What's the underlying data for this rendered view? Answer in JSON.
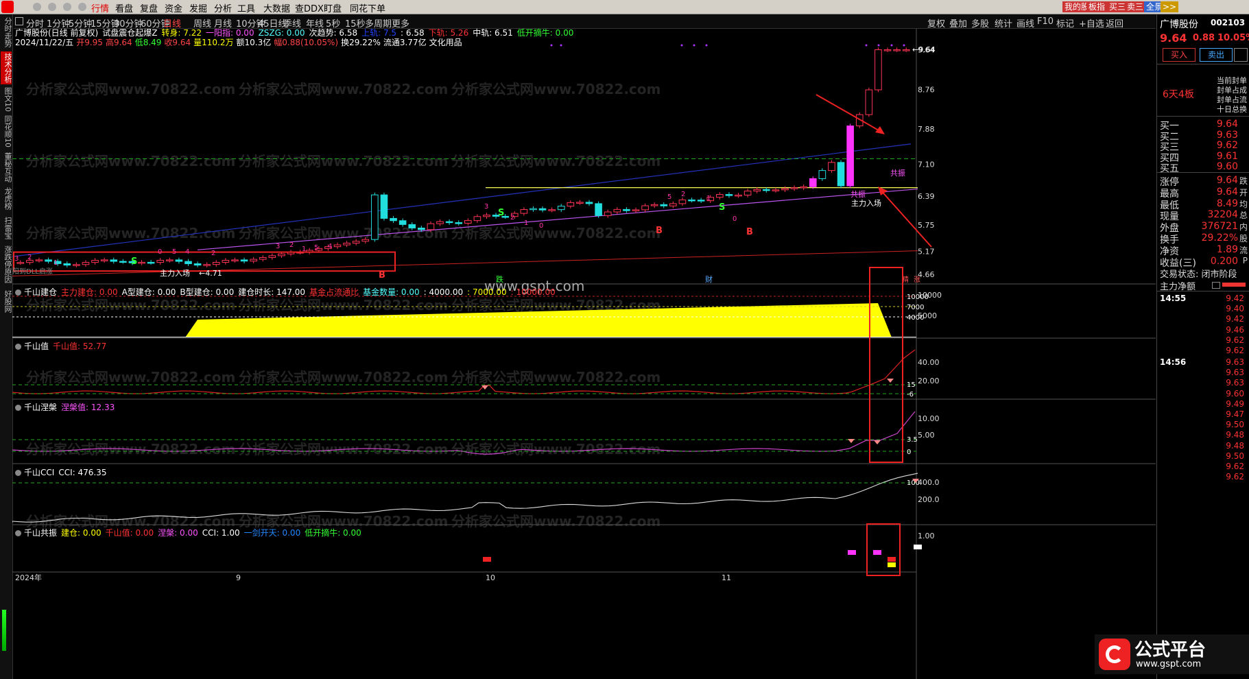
{
  "topbar": {
    "nav": [
      "行情",
      "看盘",
      "复盘",
      "资金",
      "发掘",
      "分析",
      "工具",
      "大数据",
      "查DDX",
      "盯盘",
      "同花下单"
    ],
    "right_buttons": [
      "我的股",
      "板指",
      "买三",
      "卖三",
      "全景",
      ">>"
    ]
  },
  "periods": [
    "分时",
    "1分钟",
    "5分钟",
    "15分钟",
    "30分钟",
    "60分钟",
    "日线",
    "周线",
    "月线",
    "10分钟",
    "45日线",
    "季线",
    "年线",
    "5秒",
    "15秒",
    "多周期",
    "更多"
  ],
  "toolbar_right": [
    "复权",
    "叠加",
    "多股",
    "统计",
    "画线",
    "F10",
    "标记",
    "+自选",
    "返回"
  ],
  "left_tabs": [
    "分时走势",
    "技术分析",
    "图文10",
    "同花顺10",
    "董秘互动",
    "龙虎榜",
    "扫雷宝",
    "涨跌停原因",
    "好股网"
  ],
  "main_chart": {
    "title_line1": [
      {
        "text": "广博股份(日线 前复权)",
        "color": "#ffffff"
      },
      {
        "text": "试盘震仓起爆Z",
        "color": "#ffffff"
      },
      {
        "text": "转身: 7.22",
        "color": "#ffff00"
      },
      {
        "text": "一阳指: 0.00",
        "color": "#ff55ff"
      },
      {
        "text": "ZSZG: 0.00",
        "color": "#55ffff"
      },
      {
        "text": "次趋势: 6.58",
        "color": "#ffffff"
      },
      {
        "text": "上轨: 7.5",
        "color": "#2244ff"
      },
      {
        "text": ": 6.58",
        "color": "#ffffff"
      },
      {
        "text": "下轨: 5.26",
        "color": "#ff3333"
      },
      {
        "text": "中轨: 6.51",
        "color": "#ffffff"
      },
      {
        "text": "低开摘牛: 0.00",
        "color": "#33ff33"
      }
    ],
    "title_line2": [
      {
        "text": "2024/11/22/五",
        "color": "#ffffff"
      },
      {
        "text": "开9.95",
        "color": "#ff4444"
      },
      {
        "text": "高9.64",
        "color": "#ff4444"
      },
      {
        "text": "低8.49",
        "color": "#33ff33"
      },
      {
        "text": "收9.64",
        "color": "#ff4444"
      },
      {
        "text": "量110.2万",
        "color": "#ffff00"
      },
      {
        "text": "额10.3亿",
        "color": "#ffffff"
      },
      {
        "text": "幅0.88(10.05%)",
        "color": "#ff4444"
      },
      {
        "text": "换29.22%",
        "color": "#ffffff"
      },
      {
        "text": "流通3.77亿",
        "color": "#ffffff"
      },
      {
        "text": "文化用品",
        "color": "#ffffff"
      }
    ],
    "yaxis": [
      "9.64",
      "8.76",
      "7.88",
      "7.10",
      "6.39",
      "5.75",
      "5.17",
      "4.66"
    ],
    "ylabel_last": "9.64",
    "annotations": {
      "main_force_enter_1": "主力入场",
      "main_force_enter_2": "主力入场",
      "resonance_1": "共振",
      "resonance_2": "共振",
      "arrow_val": "←4.71",
      "bl_label": "阳到DLL启涨",
      "die_label": "跌",
      "cai_label": "财",
      "jing_label": "精",
      "zhang_label": "涨",
      "b_marks": [
        "B",
        "B",
        "B"
      ],
      "s_marks": [
        "S",
        "S",
        "S"
      ],
      "num_marks": [
        "3",
        "2",
        "1",
        "0",
        "5",
        "4",
        "2",
        "3",
        "2",
        "1",
        "5",
        "4",
        "3",
        "2",
        "1",
        "0",
        "5",
        "2",
        "1",
        "0",
        "5",
        "4",
        "2",
        "3",
        "2",
        "1",
        "0"
      ]
    }
  },
  "panels": {
    "jiancang": {
      "title": [
        {
          "text": "千山建仓",
          "color": "#ffffff"
        },
        {
          "text": "主力建仓: 0.00",
          "color": "#ff3333"
        },
        {
          "text": "A型建仓: 0.00",
          "color": "#ffffff"
        },
        {
          "text": "B型建仓: 0.00",
          "color": "#ffffff"
        },
        {
          "text": "建仓时长: 147.00",
          "color": "#ffffff"
        },
        {
          "text": "基金占流通比",
          "color": "#ff3333"
        },
        {
          "text": "基金数量: 0.00",
          "color": "#55ffff"
        },
        {
          "text": ": 4000.00",
          "color": "#ffffff"
        },
        {
          "text": ": 7000.00",
          "color": "#ffff00"
        },
        {
          "text": ": 10000.00",
          "color": "#ff3333"
        }
      ],
      "yaxis": [
        "10000",
        "5000"
      ],
      "levels": [
        "10000",
        "7000",
        "4000"
      ]
    },
    "qianshanzhi": {
      "title": [
        {
          "text": "千山值",
          "color": "#ffffff"
        },
        {
          "text": "千山值: 52.77",
          "color": "#ff3333"
        }
      ],
      "yaxis": [
        "40.00",
        "20.00"
      ],
      "levels": [
        "15",
        "-6"
      ]
    },
    "niepan": {
      "title": [
        {
          "text": "千山涅槃",
          "color": "#ffffff"
        },
        {
          "text": "涅槃值: 12.33",
          "color": "#ff55ff"
        }
      ],
      "yaxis": [
        "10.00",
        "5.00"
      ],
      "levels": [
        "3.5",
        "0"
      ]
    },
    "cci": {
      "title": [
        {
          "text": "千山CCI",
          "color": "#ffffff"
        },
        {
          "text": "CCI: 476.35",
          "color": "#ffffff"
        }
      ],
      "yaxis": [
        "400.0",
        "200.0"
      ],
      "levels": [
        "100"
      ]
    },
    "gongzhen": {
      "title": [
        {
          "text": "千山共振",
          "color": "#ffffff"
        },
        {
          "text": "建仓: 0.00",
          "color": "#ffff00"
        },
        {
          "text": "千山值: 0.00",
          "color": "#ff3333"
        },
        {
          "text": "涅槃: 0.00",
          "color": "#ff55ff"
        },
        {
          "text": "CCI: 1.00",
          "color": "#ffffff"
        },
        {
          "text": "一剑开天: 0.00",
          "color": "#2288ff"
        },
        {
          "text": "低开摘牛: 0.00",
          "color": "#33ff33"
        }
      ],
      "yaxis": [
        "1.00"
      ]
    }
  },
  "xaxis": [
    "2024年",
    "9",
    "10",
    "11"
  ],
  "site_watermark": "www.gspt.com",
  "bg_watermark": "分析家公式网www.70822.com",
  "right_panel": {
    "stock_name": "广博股份",
    "code": "002103",
    "price": "9.64",
    "change": "0.88",
    "pct": "10.05%",
    "buy_btn": "买入",
    "sell_btn": "卖出",
    "limit_label": "6天4板",
    "seal_lines": [
      "当前封单",
      "封单占成",
      "封单占流",
      "十日总换"
    ],
    "bids": [
      {
        "label": "买一",
        "value": "9.64"
      },
      {
        "label": "买二",
        "value": "9.63"
      },
      {
        "label": "买三",
        "value": "9.62"
      },
      {
        "label": "买四",
        "value": "9.61"
      },
      {
        "label": "买五",
        "value": "9.60"
      }
    ],
    "stats": [
      {
        "label": "涨停",
        "value": "9.64",
        "extra": "跌"
      },
      {
        "label": "最高",
        "value": "9.64",
        "extra": "开"
      },
      {
        "label": "最低",
        "value": "8.49",
        "extra": "均"
      },
      {
        "label": "现量",
        "value": "32204",
        "extra": "总"
      },
      {
        "label": "外盘",
        "value": "376721",
        "extra": "内"
      },
      {
        "label": "换手",
        "value": "29.22%",
        "extra": "股"
      },
      {
        "label": "净资",
        "value": "1.89",
        "extra": "流"
      },
      {
        "label": "收益(三)",
        "value": "0.200",
        "extra": "P"
      }
    ],
    "trade_state": "交易状态: 闭市阶段",
    "main_net": "主力净额",
    "ticks_time1": "14:55",
    "ticks1": [
      "9.42",
      "9.40",
      "9.42",
      "9.46",
      "9.62",
      "9.62"
    ],
    "ticks_time2": "14:56",
    "ticks2": [
      "9.63",
      "9.63",
      "9.63",
      "9.60",
      "9.49",
      "9.47",
      "9.50",
      "9.48",
      "9.48",
      "9.50",
      "9.62",
      "9.62"
    ]
  },
  "brand": {
    "name": "公式平台",
    "url": "www.gspt.com"
  }
}
